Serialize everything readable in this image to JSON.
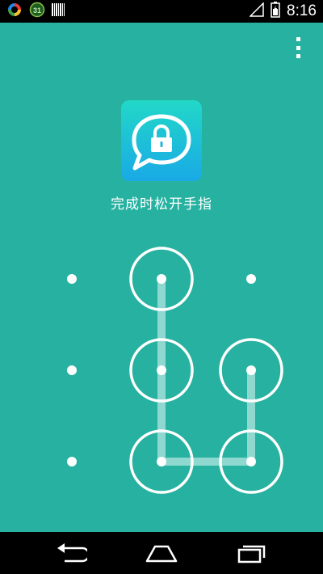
{
  "status_bar": {
    "time": "8:16",
    "left_icons": [
      "sync-icon",
      "calendar-31-icon",
      "barcode-icon"
    ],
    "calendar_day": "31",
    "right_icons": [
      "signal-icon",
      "battery-icon"
    ]
  },
  "toolbar": {
    "menu_icon": "overflow-menu-icon"
  },
  "app": {
    "icon": "lock-chat-icon",
    "instruction": "完成时松开手指"
  },
  "pattern": {
    "grid": "3x3",
    "selected_dots": [
      2,
      5,
      8,
      9,
      6
    ],
    "colors": {
      "background": "#26b1a0",
      "dot": "#ffffff",
      "ring": "#ffffff",
      "path": "#8fd8cf"
    }
  },
  "nav_bar": {
    "buttons": [
      "back-icon",
      "home-icon",
      "recents-icon"
    ]
  }
}
